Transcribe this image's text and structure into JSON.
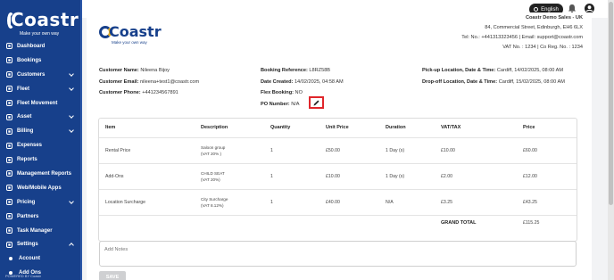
{
  "sidebar": {
    "brand": "Coastr",
    "tagline": "Make your own way",
    "items": [
      {
        "label": "Dashboard",
        "icon": "dashboard-icon",
        "chevron": false
      },
      {
        "label": "Bookings",
        "icon": "calendar-icon",
        "chevron": false
      },
      {
        "label": "Customers",
        "icon": "users-icon",
        "chevron": true
      },
      {
        "label": "Fleet",
        "icon": "car-icon",
        "chevron": true
      },
      {
        "label": "Fleet Movement",
        "icon": "truck-icon",
        "chevron": false
      },
      {
        "label": "Asset",
        "icon": "box-icon",
        "chevron": true
      },
      {
        "label": "Billing",
        "icon": "wallet-icon",
        "chevron": true
      },
      {
        "label": "Expenses",
        "icon": "receipt-icon",
        "chevron": false
      },
      {
        "label": "Reports",
        "icon": "report-icon",
        "chevron": false
      },
      {
        "label": "Management Reports",
        "icon": "chart-icon",
        "chevron": false
      },
      {
        "label": "Web/Mobile Apps",
        "icon": "globe-icon",
        "chevron": false
      },
      {
        "label": "Pricing",
        "icon": "tag-icon",
        "chevron": true
      },
      {
        "label": "Partners",
        "icon": "handshake-icon",
        "chevron": false
      },
      {
        "label": "Task Manager",
        "icon": "tasks-icon",
        "chevron": false
      },
      {
        "label": "Settings",
        "icon": "gear-icon",
        "chevron": true
      }
    ],
    "subitems": [
      "Account",
      "Add Ons"
    ],
    "powered_by": "POWERED BY Coastr"
  },
  "topbar": {
    "language": "English"
  },
  "company": {
    "name": "Coastr Demo Sales - UK",
    "address": "84, Commercial Street, Edinburgh, EH6 6LX",
    "contact": "Tel: No.: +441313323456 | Email: support@coastr.com",
    "reg": "VAT No. : 1234 | Co Reg. No. : 1234"
  },
  "invoice_brand": {
    "name": "Coastr",
    "tagline": "Make your own way"
  },
  "customer": {
    "name_label": "Customer Name:",
    "name": "Nileena Bijoy",
    "email_label": "Customer Email:",
    "email": "nileena+test1@coastr.com",
    "phone_label": "Customer Phone:",
    "phone": "+441234567891"
  },
  "booking": {
    "ref_label": "Booking Reference:",
    "ref": "L8RZ58B",
    "date_label": "Date Created:",
    "date": "14/02/2025, 04:58 AM",
    "flex_label": "Flex Booking:",
    "flex": "NO",
    "po_label": "PO Number:",
    "po": "N/A"
  },
  "locations": {
    "pickup_label": "Pick-up Location, Date & Time:",
    "pickup": "Cardiff, 14/02/2025, 08:00 AM",
    "dropoff_label": "Drop-off Location, Date & Time:",
    "dropoff": "Cardiff, 15/02/2025, 08:00 AM"
  },
  "table": {
    "headers": [
      "Item",
      "Description",
      "Quantity",
      "Unit Price",
      "Duration",
      "VAT/TAX",
      "Price"
    ],
    "rows": [
      {
        "item": "Rental Price",
        "desc1": "Saloon group",
        "desc2": "(VAT 20% )",
        "qty": "1",
        "unit": "£50.00",
        "duration": "1 Day (s)",
        "vat": "£10.00",
        "price": "£60.00"
      },
      {
        "item": "Add-Ons",
        "desc1": "CHILD SEAT",
        "desc2": "(VAT 20%)",
        "qty": "1",
        "unit": "£10.00",
        "duration": "1 Day (s)",
        "vat": "£2.00",
        "price": "£12.00"
      },
      {
        "item": "Location Surcharge",
        "desc1": "City Surcharge",
        "desc2": "(VAT 8.12%)",
        "qty": "1",
        "unit": "£40.00",
        "duration": "N/A",
        "vat": "£3.25",
        "price": "£43.25"
      }
    ],
    "grand_total_label": "GRAND TOTAL",
    "grand_total": "£115.25"
  },
  "notes": {
    "placeholder": "Add Notes"
  },
  "save_label": "SAVE"
}
